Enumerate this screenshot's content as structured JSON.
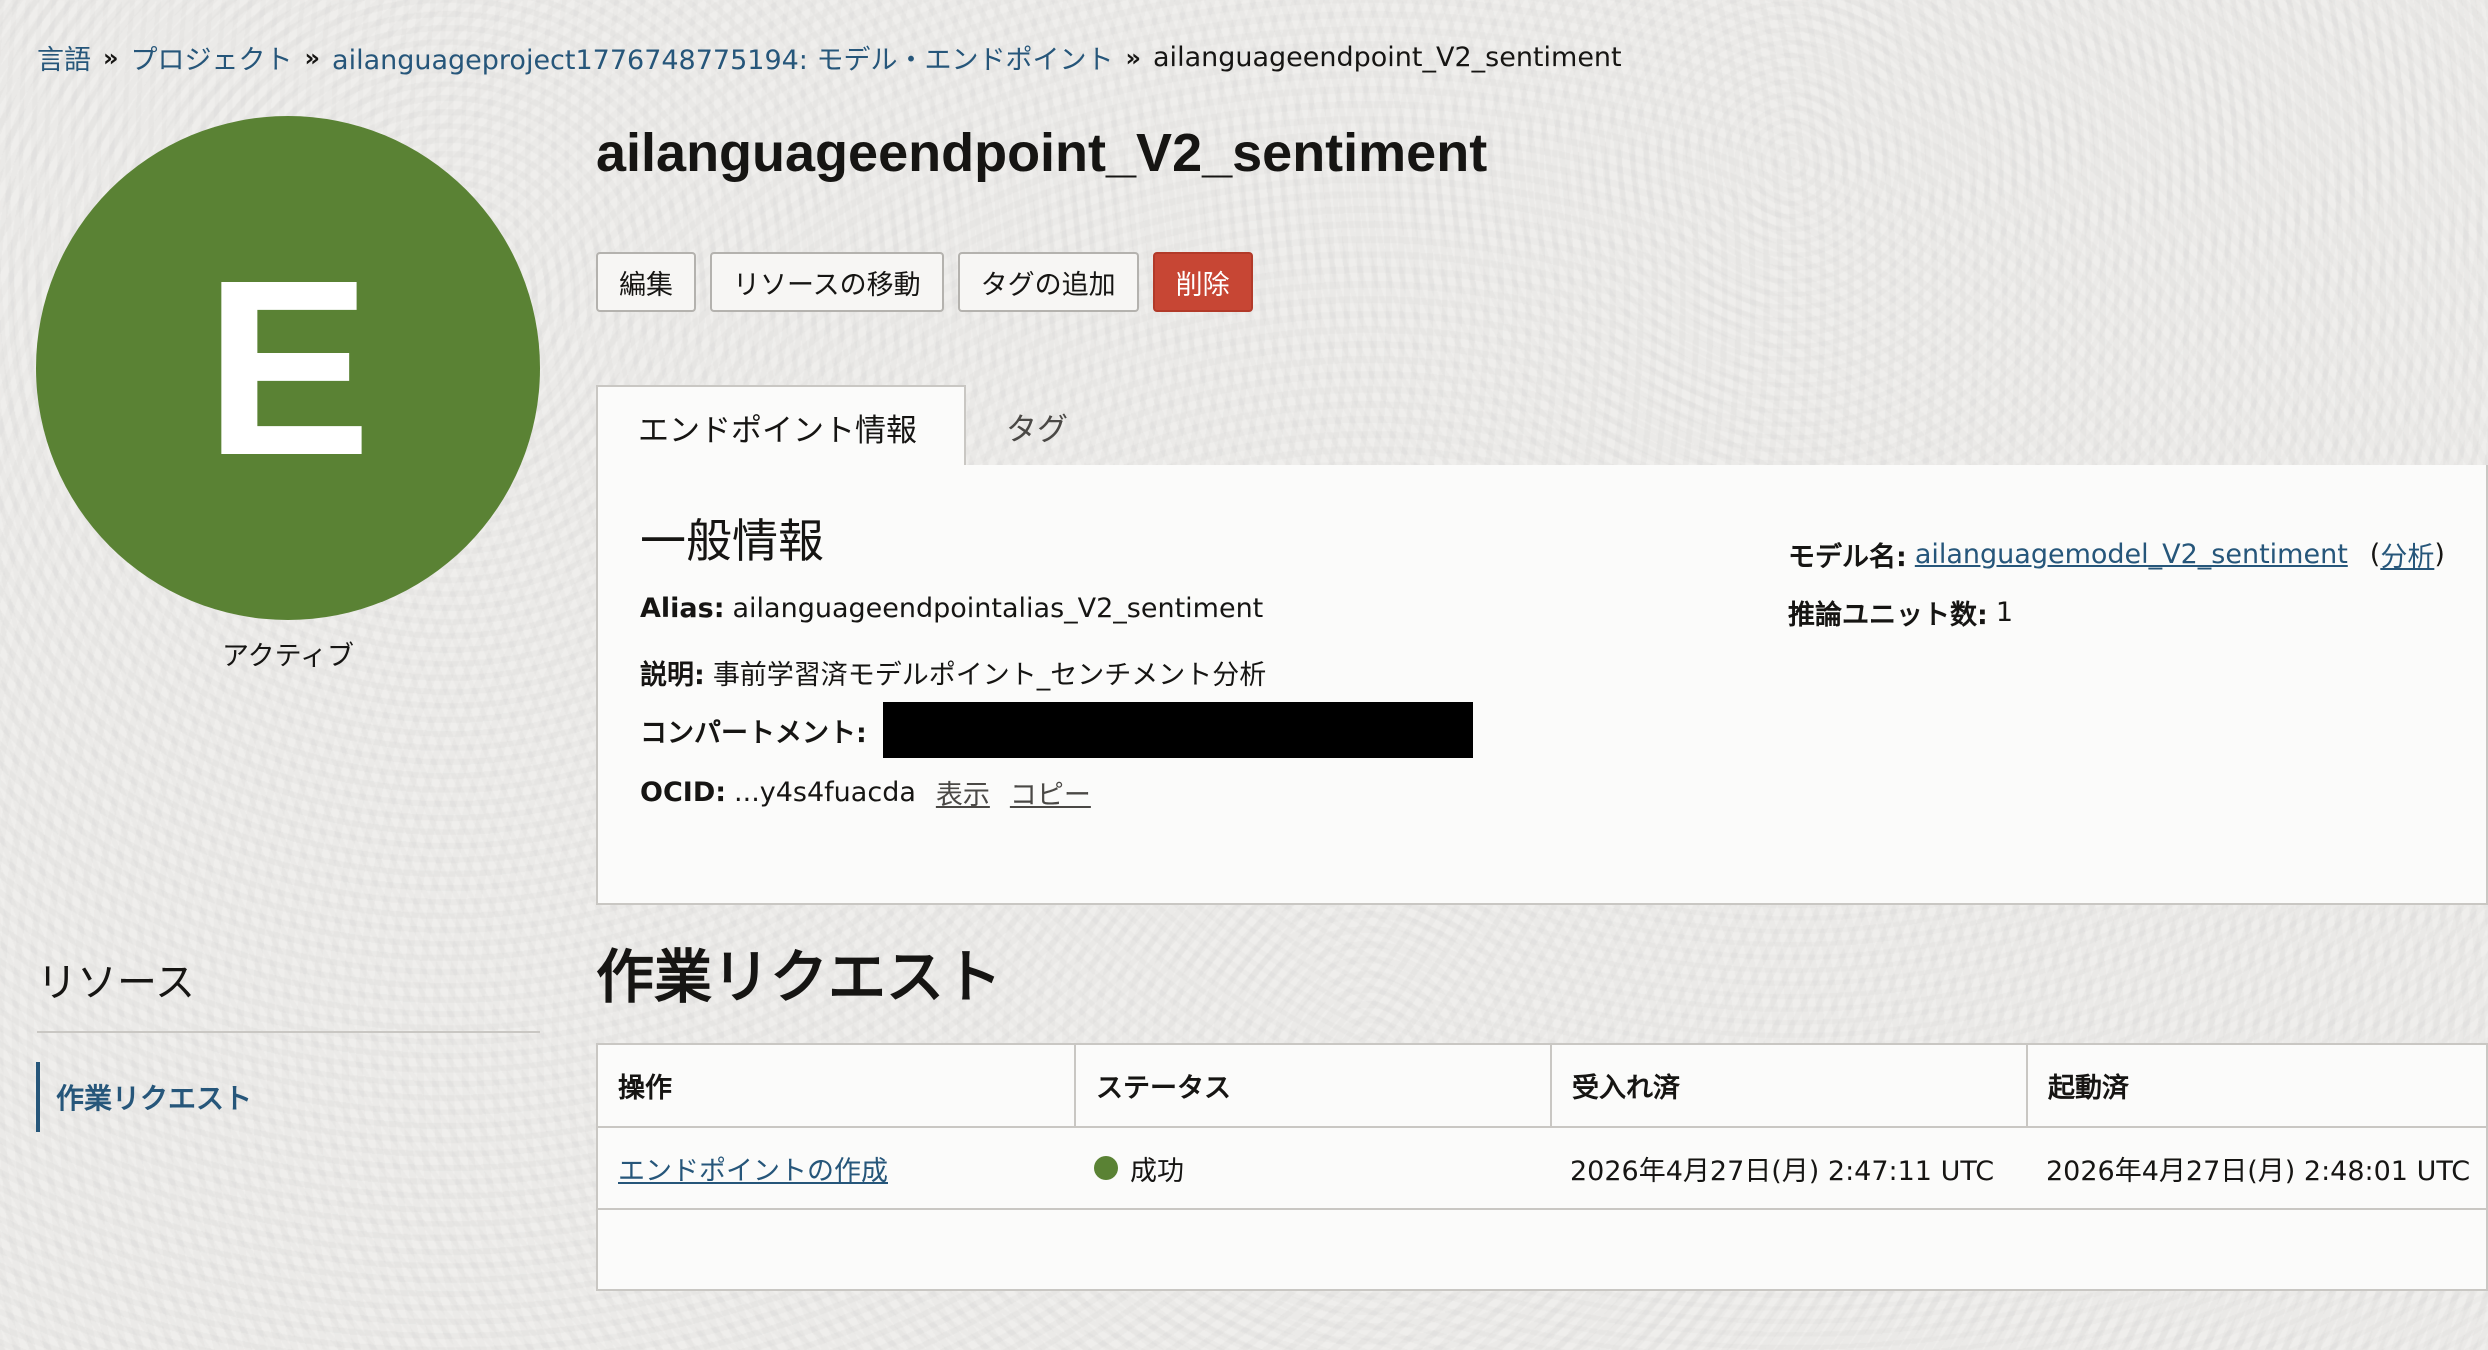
{
  "breadcrumb": {
    "items": [
      "言語",
      "プロジェクト",
      "ailanguageproject1776748775194: モデル・エンドポイント"
    ],
    "separator": "»",
    "current": "ailanguageendpoint_V2_sentiment"
  },
  "avatar": {
    "letter": "E",
    "color": "#5a8234"
  },
  "status": "アクティブ",
  "resources": {
    "title": "リソース",
    "items": [
      "作業リクエスト"
    ]
  },
  "title": "ailanguageendpoint_V2_sentiment",
  "actions": {
    "edit": "編集",
    "move": "リソースの移動",
    "add_tags": "タグの追加",
    "delete": "削除"
  },
  "tabs": {
    "info": "エンドポイント情報",
    "tags": "タグ"
  },
  "general": {
    "title": "一般情報",
    "alias_label": "Alias:",
    "alias_value": "ailanguageendpointalias_V2_sentiment",
    "desc_label": "説明:",
    "desc_value": "事前学習済モデルポイント_センチメント分析",
    "compartment_label": "コンパートメント:",
    "ocid_label": "OCID:",
    "ocid_value": "...y4s4fuacda",
    "show": "表示",
    "copy": "コピー",
    "model_label": "モデル名:",
    "model_value": "ailanguagemodel_V2_sentiment",
    "analyze_open": "(",
    "analyze": "分析",
    "analyze_close": ")",
    "units_label": "推論ユニット数:",
    "units_value": "1"
  },
  "work_requests": {
    "title": "作業リクエスト",
    "headers": [
      "操作",
      "ステータス",
      "受入れ済",
      "起動済"
    ],
    "rows": [
      {
        "operation": "エンドポイントの作成",
        "status": "成功",
        "accepted": "2026年4月27日(月) 2:47:11 UTC",
        "started": "2026年4月27日(月) 2:48:01 UTC"
      }
    ]
  },
  "colors": {
    "link": "#26567a",
    "success": "#5a8234",
    "danger": "#c74634"
  }
}
